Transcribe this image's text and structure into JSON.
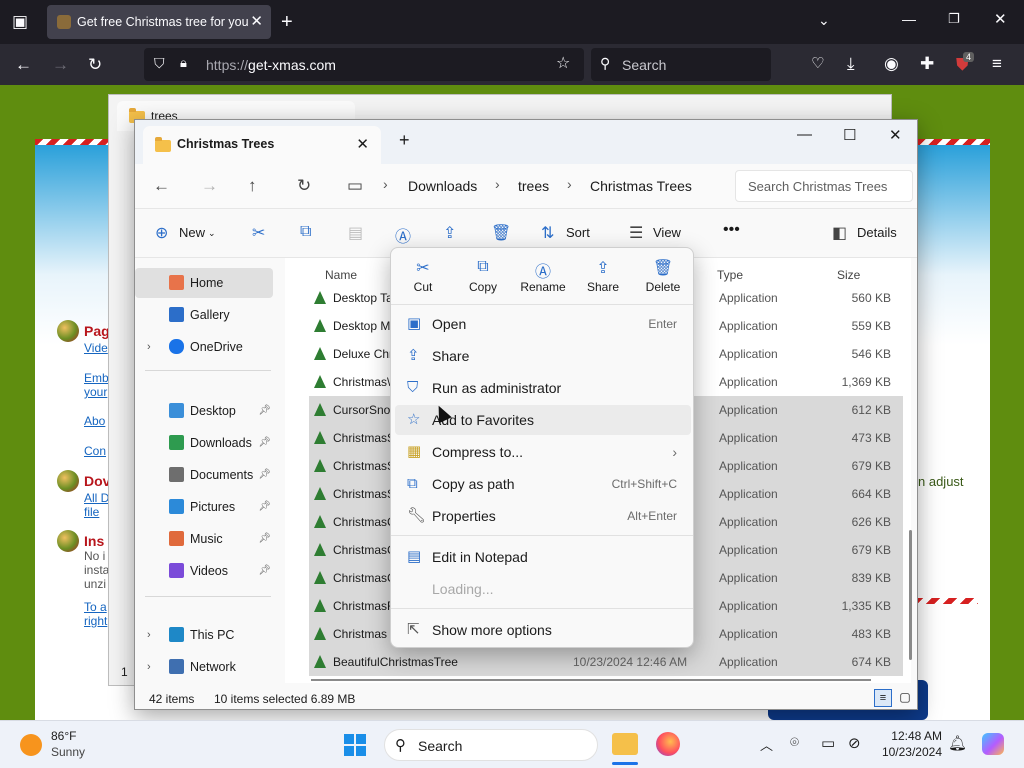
{
  "browser": {
    "tab_title": "Get free Christmas tree for you",
    "url_protocol": "https://",
    "url_host": "get-xmas.com",
    "search_placeholder": "Search",
    "extension_badge": "4"
  },
  "site": {
    "head1": "Pag",
    "link1": "Vide",
    "link2": "Emb",
    "link2b": "your",
    "link3": "Abo",
    "link4": "Con",
    "head2": "Dov",
    "link5": "All D",
    "link5b": "file",
    "head3": "Ins",
    "text1": "No i",
    "text2": "insta",
    "text3": "unzi",
    "link6": "To a",
    "link6b": "right",
    "right_text": "n  adjust"
  },
  "back_window": {
    "tab_title": "trees",
    "footer": "1"
  },
  "window": {
    "tab_title": "Christmas Trees",
    "breadcrumbs": [
      "Downloads",
      "trees",
      "Christmas Trees"
    ],
    "search_placeholder": "Search Christmas Trees",
    "commands": {
      "new": "New",
      "sort": "Sort",
      "view": "View",
      "details": "Details"
    }
  },
  "navpane": {
    "items": [
      {
        "label": "Home",
        "color": "#e8734a"
      },
      {
        "label": "Gallery",
        "color": "#2c6ec9"
      },
      {
        "label": "OneDrive",
        "color": "#1a73e8"
      },
      {
        "label": "Desktop",
        "color": "#3b8fd9"
      },
      {
        "label": "Downloads",
        "color": "#2e9b4f"
      },
      {
        "label": "Documents",
        "color": "#6e6e6e"
      },
      {
        "label": "Pictures",
        "color": "#2c8ad9"
      },
      {
        "label": "Music",
        "color": "#e06a3c"
      },
      {
        "label": "Videos",
        "color": "#7b4bd9"
      },
      {
        "label": "This PC",
        "color": "#1e88c7"
      },
      {
        "label": "Network",
        "color": "#3f6fb0"
      }
    ]
  },
  "filelist": {
    "columns": {
      "name": "Name",
      "type": "Type",
      "size": "Size"
    },
    "rows": [
      {
        "name": "Desktop Ta",
        "date": "",
        "type": "Application",
        "size": "560 KB",
        "selected": false
      },
      {
        "name": "Desktop M",
        "date": "",
        "type": "Application",
        "size": "559 KB",
        "selected": false
      },
      {
        "name": "Deluxe Chr",
        "date": "",
        "type": "Application",
        "size": "546 KB",
        "selected": false
      },
      {
        "name": "Christmas\\",
        "date": "",
        "type": "Application",
        "size": "1,369 KB",
        "selected": false
      },
      {
        "name": "CursorSno",
        "date": "",
        "type": "Application",
        "size": "612 KB",
        "selected": true
      },
      {
        "name": "ChristmasS",
        "date": "",
        "type": "Application",
        "size": "473 KB",
        "selected": true
      },
      {
        "name": "ChristmasS",
        "date": "",
        "type": "Application",
        "size": "679 KB",
        "selected": true
      },
      {
        "name": "ChristmasS",
        "date": "",
        "type": "Application",
        "size": "664 KB",
        "selected": true
      },
      {
        "name": "ChristmasC",
        "date": "",
        "type": "Application",
        "size": "626 KB",
        "selected": true
      },
      {
        "name": "ChristmasC",
        "date": "",
        "type": "Application",
        "size": "679 KB",
        "selected": true
      },
      {
        "name": "ChristmasC",
        "date": "",
        "type": "Application",
        "size": "839 KB",
        "selected": true
      },
      {
        "name": "ChristmasF",
        "date": "",
        "type": "Application",
        "size": "1,335 KB",
        "selected": true
      },
      {
        "name": "Christmas",
        "date": "",
        "type": "Application",
        "size": "483 KB",
        "selected": true
      },
      {
        "name": "BeautifulChristmasTree",
        "date": "10/23/2024 12:46 AM",
        "type": "Application",
        "size": "674 KB",
        "selected": true
      }
    ]
  },
  "status": {
    "item_count": "42 items",
    "selected": "10 items selected  6.89 MB"
  },
  "context_menu": {
    "quick_actions": [
      "Cut",
      "Copy",
      "Rename",
      "Share",
      "Delete"
    ],
    "items": [
      {
        "label": "Open",
        "shortcut": "Enter",
        "icon": "open-icon"
      },
      {
        "label": "Share",
        "shortcut": "",
        "icon": "share-icon"
      },
      {
        "label": "Run as administrator",
        "shortcut": "",
        "icon": "shield-icon"
      },
      {
        "label": "Add to Favorites",
        "shortcut": "",
        "icon": "star-icon"
      },
      {
        "label": "Compress to...",
        "shortcut": "",
        "icon": "zip-icon"
      },
      {
        "label": "Copy as path",
        "shortcut": "Ctrl+Shift+C",
        "icon": "copy-path-icon"
      },
      {
        "label": "Properties",
        "shortcut": "Alt+Enter",
        "icon": "wrench-icon"
      },
      {
        "label": "Edit in Notepad",
        "shortcut": "",
        "icon": "notepad-icon"
      },
      {
        "label": "Loading...",
        "shortcut": "",
        "icon": ""
      },
      {
        "label": "Show more options",
        "shortcut": "",
        "icon": "more-options-icon"
      }
    ]
  },
  "taskbar": {
    "temperature": "86°F",
    "weather": "Sunny",
    "search_label": "Search",
    "time": "12:48 AM",
    "date": "10/23/2024"
  }
}
